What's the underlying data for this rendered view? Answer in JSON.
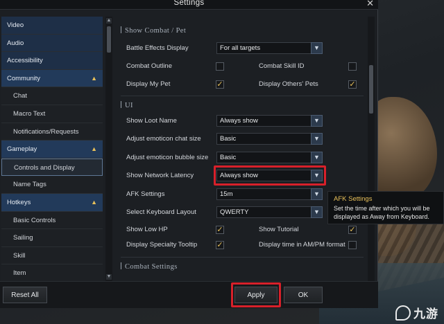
{
  "window": {
    "title": "Settings",
    "close_glyph": "✕"
  },
  "sidebar": {
    "items": [
      {
        "label": "Video",
        "kind": "cat-plain"
      },
      {
        "label": "Audio",
        "kind": "cat-plain"
      },
      {
        "label": "Accessibility",
        "kind": "cat-plain"
      },
      {
        "label": "Community",
        "kind": "cat",
        "chev": "▲"
      },
      {
        "label": "Chat",
        "kind": "sub"
      },
      {
        "label": "Macro Text",
        "kind": "sub"
      },
      {
        "label": "Notifications/Requests",
        "kind": "sub"
      },
      {
        "label": "Gameplay",
        "kind": "cat",
        "chev": "▲"
      },
      {
        "label": "Controls and Display",
        "kind": "sub",
        "active": true
      },
      {
        "label": "Name Tags",
        "kind": "sub"
      },
      {
        "label": "Hotkeys",
        "kind": "cat",
        "chev": "▲"
      },
      {
        "label": "Basic Controls",
        "kind": "sub"
      },
      {
        "label": "Sailing",
        "kind": "sub"
      },
      {
        "label": "Skill",
        "kind": "sub"
      },
      {
        "label": "Item",
        "kind": "sub"
      }
    ]
  },
  "sections": {
    "combat_pet": "Show Combat / Pet",
    "ui": "UI",
    "combat_settings": "Combat Settings"
  },
  "combat": {
    "battle_effects_label": "Battle Effects Display",
    "battle_effects_value": "For all targets",
    "combat_outline_label": "Combat Outline",
    "combat_outline_checked": false,
    "combat_skill_id_label": "Combat Skill ID",
    "combat_skill_id_checked": false,
    "display_my_pet_label": "Display My Pet",
    "display_my_pet_checked": true,
    "display_others_pets_label": "Display Others' Pets",
    "display_others_pets_checked": true
  },
  "ui": {
    "show_loot_name_label": "Show Loot Name",
    "show_loot_name_value": "Always show",
    "emoticon_chat_label": "Adjust emoticon chat size",
    "emoticon_chat_value": "Basic",
    "emoticon_bubble_label": "Adjust emoticon bubble size",
    "emoticon_bubble_value": "Basic",
    "network_latency_label": "Show Network Latency",
    "network_latency_value": "Always show",
    "afk_label": "AFK Settings",
    "afk_value": "15m",
    "keyboard_layout_label": "Select Keyboard Layout",
    "keyboard_layout_value": "QWERTY",
    "show_low_hp_label": "Show Low HP",
    "show_low_hp_checked": true,
    "show_tutorial_label": "Show Tutorial",
    "show_tutorial_checked": true,
    "specialty_tooltip_label": "Display Specialty Tooltip",
    "specialty_tooltip_checked": true,
    "time_ampm_label": "Display time in AM/PM format",
    "time_ampm_checked": false
  },
  "tooltip": {
    "title": "AFK Settings",
    "body": "Set the time after which you will be displayed as Away from Keyboard."
  },
  "footer": {
    "reset_all": "Reset All",
    "apply": "Apply",
    "ok": "OK"
  },
  "glyphs": {
    "dropdown": "▼",
    "check": "✓",
    "scroll_up": "▲",
    "scroll_down": "▼"
  },
  "watermark": {
    "text": "九游"
  },
  "colors": {
    "accent_gold": "#e8c05a",
    "highlight_red": "#d8202a",
    "category_blue": "#223a5a"
  }
}
